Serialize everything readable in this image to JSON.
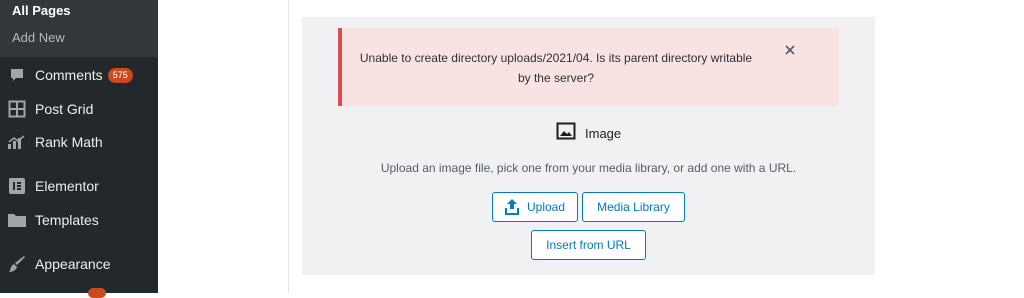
{
  "sidebar": {
    "submenu": {
      "all_pages": "All Pages",
      "add_new": "Add New"
    },
    "items": [
      {
        "label": "Comments",
        "icon": "comment-icon",
        "badge": "575"
      },
      {
        "label": "Post Grid",
        "icon": "grid-icon"
      },
      {
        "label": "Rank Math",
        "icon": "chart-icon"
      },
      {
        "label": "Elementor",
        "icon": "elementor-icon"
      },
      {
        "label": "Templates",
        "icon": "folder-icon"
      },
      {
        "label": "Appearance",
        "icon": "brush-icon"
      }
    ]
  },
  "notice": {
    "message": "Unable to create directory uploads/2021/04. Is its parent directory writable by the server?",
    "close_icon": "close-icon"
  },
  "image_block": {
    "title": "Image",
    "instructions": "Upload an image file, pick one from your media library, or add one with a URL.",
    "upload_label": "Upload",
    "media_library_label": "Media Library",
    "insert_url_label": "Insert from URL"
  },
  "colors": {
    "sidebar_bg": "#23282d",
    "badge": "#ca4a1f",
    "notice_border": "#d94f4f",
    "notice_bg": "#f9e2e2",
    "accent": "#007cba"
  }
}
